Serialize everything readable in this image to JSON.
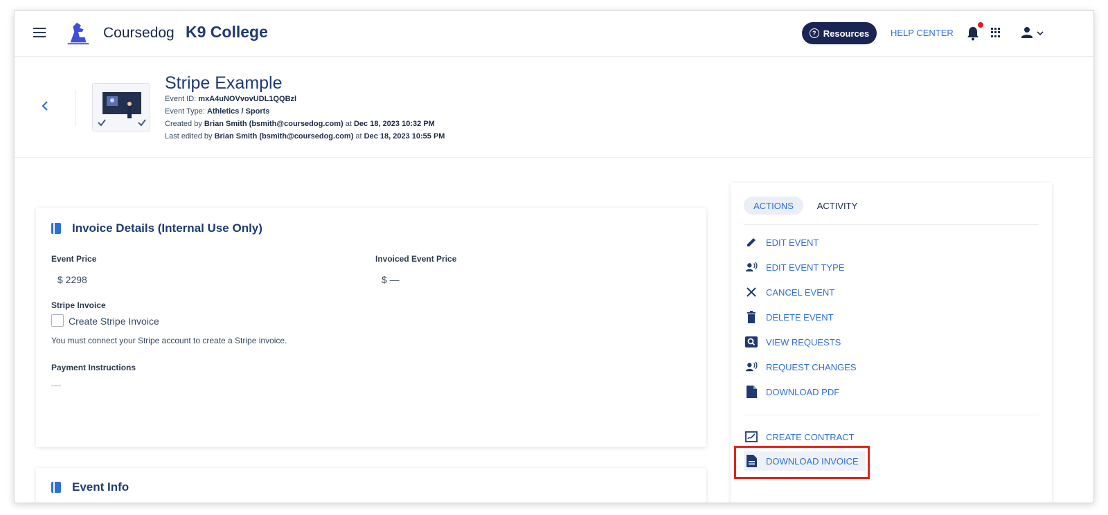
{
  "header": {
    "brand": "Coursedog",
    "college": "K9 College",
    "resources_label": "Resources",
    "help_center_label": "HELP CENTER"
  },
  "event": {
    "title": "Stripe Example",
    "id_label": "Event ID: ",
    "id_value": "mxA4uNOVvovUDL1QQBzl",
    "type_label": "Event Type: ",
    "type_value": "Athletics / Sports",
    "created_label": "Created by ",
    "created_by": "Brian Smith (bsmith@coursedog.com)",
    "created_at_label": " at ",
    "created_at": "Dec 18, 2023 10:32 PM",
    "edited_label": "Last edited by ",
    "edited_by": "Brian Smith (bsmith@coursedog.com)",
    "edited_at_label": " at ",
    "edited_at": "Dec 18, 2023 10:55 PM"
  },
  "invoice": {
    "title": "Invoice Details (Internal Use Only)",
    "event_price_label": "Event Price",
    "event_price_value": "$ 2298",
    "invoiced_price_label": "Invoiced Event Price",
    "invoiced_price_value": "$ —",
    "stripe_label": "Stripe Invoice",
    "create_stripe_label": "Create Stripe Invoice",
    "stripe_note": "You must connect your Stripe account to create a Stripe invoice.",
    "payment_label": "Payment Instructions",
    "payment_value": "—"
  },
  "event_info": {
    "title": "Event Info"
  },
  "panel": {
    "tabs": [
      "ACTIONS",
      "ACTIVITY"
    ],
    "actions": [
      {
        "label": "EDIT EVENT",
        "icon": "pencil-icon"
      },
      {
        "label": "EDIT EVENT TYPE",
        "icon": "person-voice-icon"
      },
      {
        "label": "CANCEL EVENT",
        "icon": "close-icon"
      },
      {
        "label": "DELETE EVENT",
        "icon": "trash-icon"
      },
      {
        "label": "VIEW REQUESTS",
        "icon": "search-box-icon"
      },
      {
        "label": "REQUEST CHANGES",
        "icon": "person-voice-icon"
      },
      {
        "label": "DOWNLOAD PDF",
        "icon": "file-icon"
      },
      {
        "label": "CREATE CONTRACT",
        "icon": "contract-icon"
      },
      {
        "label": "DOWNLOAD INVOICE",
        "icon": "document-icon"
      }
    ]
  },
  "colors": {
    "accent": "#2e6fd8",
    "navy": "#1f3a72",
    "resources_bg": "#1b2553",
    "highlight_border": "#e0241a",
    "notification": "#e8181f"
  }
}
